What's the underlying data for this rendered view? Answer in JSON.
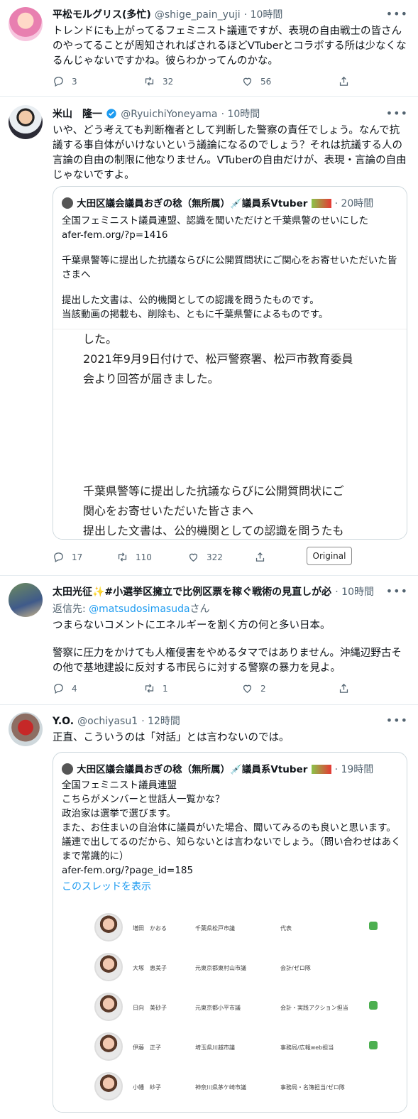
{
  "tweets": [
    {
      "name": "平松モルグリス(多忙)",
      "handle": "@shige_pain_yuji",
      "time": "· 10時間",
      "text": "トレンドにも上がってるフェミニスト議連ですが、表現の自由戦士の皆さんのやってることが周知されればされるほどVTuberとコラボする所は少なくなるんじゃないですかね。彼らわかってんのかな。",
      "replies": "3",
      "retweets": "32",
      "likes": "56"
    },
    {
      "name": "米山　隆一",
      "handle": "@RyuichiYoneyama",
      "time": "· 10時間",
      "text": "いや、どう考えても判断権者として判断した警察の責任でしょう。なんで抗議する事自体がいけないという議論になるのでしょう？それは抗議する人の言論の自由の制限に他なりません。VTuberの自由だけが、表現・言論の自由じゃないですよ。",
      "replies": "17",
      "retweets": "110",
      "likes": "322",
      "original_label": "Original",
      "quote": {
        "name": "大田区議会議員おぎの稔（無所属）💉議員系Vtuber",
        "time": "· 20時間",
        "line1": "全国フェミニスト議員連盟、認識を聞いただけと千葉県警のせいにした",
        "link": "afer-fem.org/?p=1416",
        "para2": "千葉県警等に提出した抗議ならびに公開質問状にご関心をお寄せいただいた皆さまへ",
        "para3a": "提出した文書は、公的機関としての認識を問うたものです。",
        "para3b": "当該動画の掲載も、削除も、ともに千葉県警によるものです。",
        "img_line0": "した。",
        "img_line1": "2021年9月9日付けで、松戸警察署、松戸市教育委員",
        "img_line2": "会より回答が届きました。",
        "img_line3": "千葉県警等に提出した抗議ならびに公開質問状にご",
        "img_line4": "関心をお寄せいただいた皆さまへ",
        "img_line5": "提出した文書は、公的機関としての認識を問うたも"
      }
    },
    {
      "name": "太田光征✨#小選挙区擁立で比例区票を稼ぐ戦術の見直しが必",
      "time": "· 10時間",
      "reply_prefix": "返信先: ",
      "reply_to": "@matsudosimasuda",
      "reply_suffix": "さん",
      "text1": "つまらないコメントにエネルギーを割く方の何と多い日本。",
      "text2": "警察に圧力をかけても人権侵害をやめるタマではありません。沖縄辺野古その他で基地建設に反対する市民らに対する警察の暴力を見よ。",
      "replies": "4",
      "retweets": "1",
      "likes": "2"
    },
    {
      "name": "Y.O.",
      "handle": "@ochiyasu1",
      "time": "· 12時間",
      "text": "正直、こういうのは「対話」とは言わないのでは。",
      "quote": {
        "name": "大田区議会議員おぎの稔（無所属）💉議員系Vtuber",
        "time": "· 19時間",
        "line1": "全国フェミニスト議員連盟",
        "line2": "こちらがメンバーと世話人一覧かな？",
        "line3": "政治家は選挙で選びます。",
        "line4": "また、お住まいの自治体に議員がいた場合、聞いてみるのも良いと思います。議連で出してるのだから、知らないとは言わないでしょう。（問い合わせはあくまで常識的に）",
        "link": "afer-fem.org/?page_id=185",
        "thread_link": "このスレッドを表示",
        "members": [
          {
            "name": "増田　かおる",
            "office": "千葉県松戸市議",
            "role": "代表"
          },
          {
            "name": "大塚　恵美子",
            "office": "元東京都東村山市議",
            "role": "会計/ゼロ隊"
          },
          {
            "name": "日向　美砂子",
            "office": "元東京都小平市議",
            "role": "会計・実践アクション担当"
          },
          {
            "name": "伊藤　正子",
            "office": "埼玉県川越市議",
            "role": "事務局/広報web担当"
          },
          {
            "name": "小幡　紗子",
            "office": "神奈川県茅ケ崎市議",
            "role": "事務局・名簿担当/ゼロ隊"
          }
        ]
      }
    }
  ],
  "icons": [
    "reply-icon",
    "retweet-icon",
    "like-icon",
    "share-icon",
    "more-icon",
    "verified-icon"
  ],
  "colors": {
    "accent": "#1d9bf0",
    "text": "#0f1419",
    "muted": "#536471",
    "border": "#cfd9de"
  }
}
